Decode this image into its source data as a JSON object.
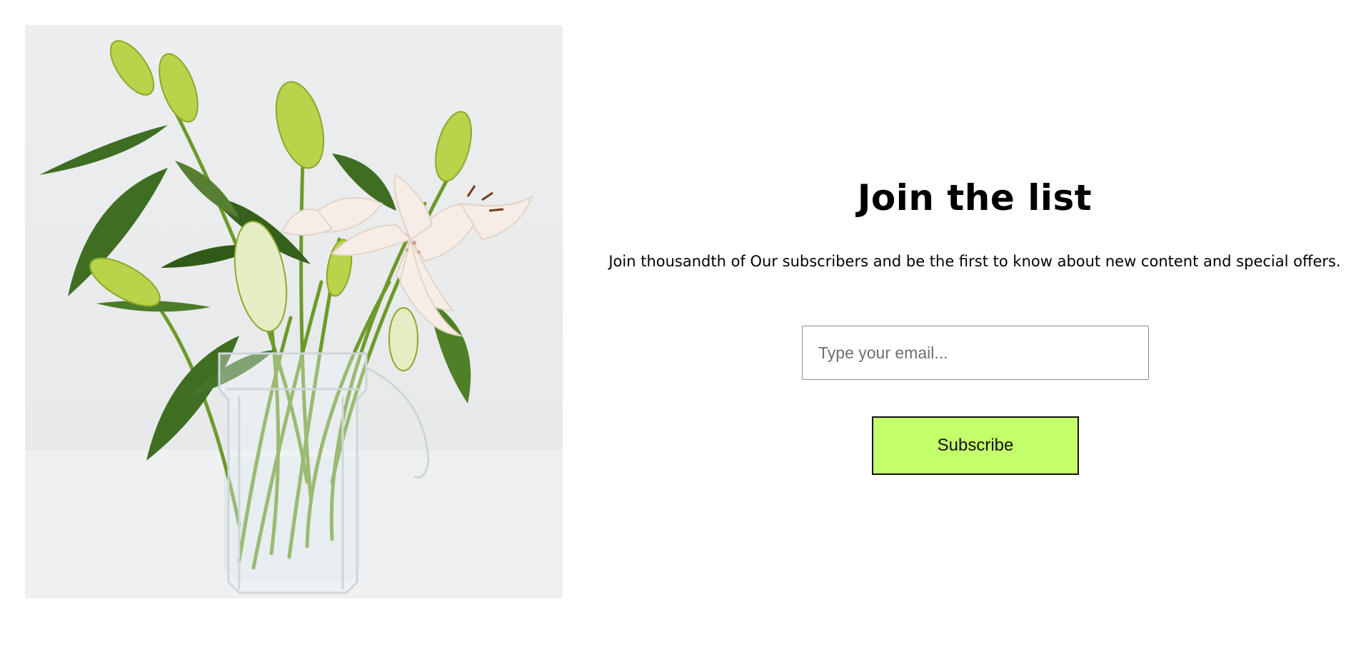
{
  "hero_image": {
    "subject": "white lilies in a glass pitcher vase"
  },
  "signup": {
    "title": "Join the list",
    "subtitle": "Join thousandth of Our subscribers and be the first to know about new content and special offers.",
    "email_placeholder": "Type your email...",
    "email_value": "",
    "button_label": "Subscribe"
  },
  "colors": {
    "background": "#ffffff",
    "button_background": "#c3ff6a",
    "button_border": "#111111",
    "text": "#000000"
  }
}
